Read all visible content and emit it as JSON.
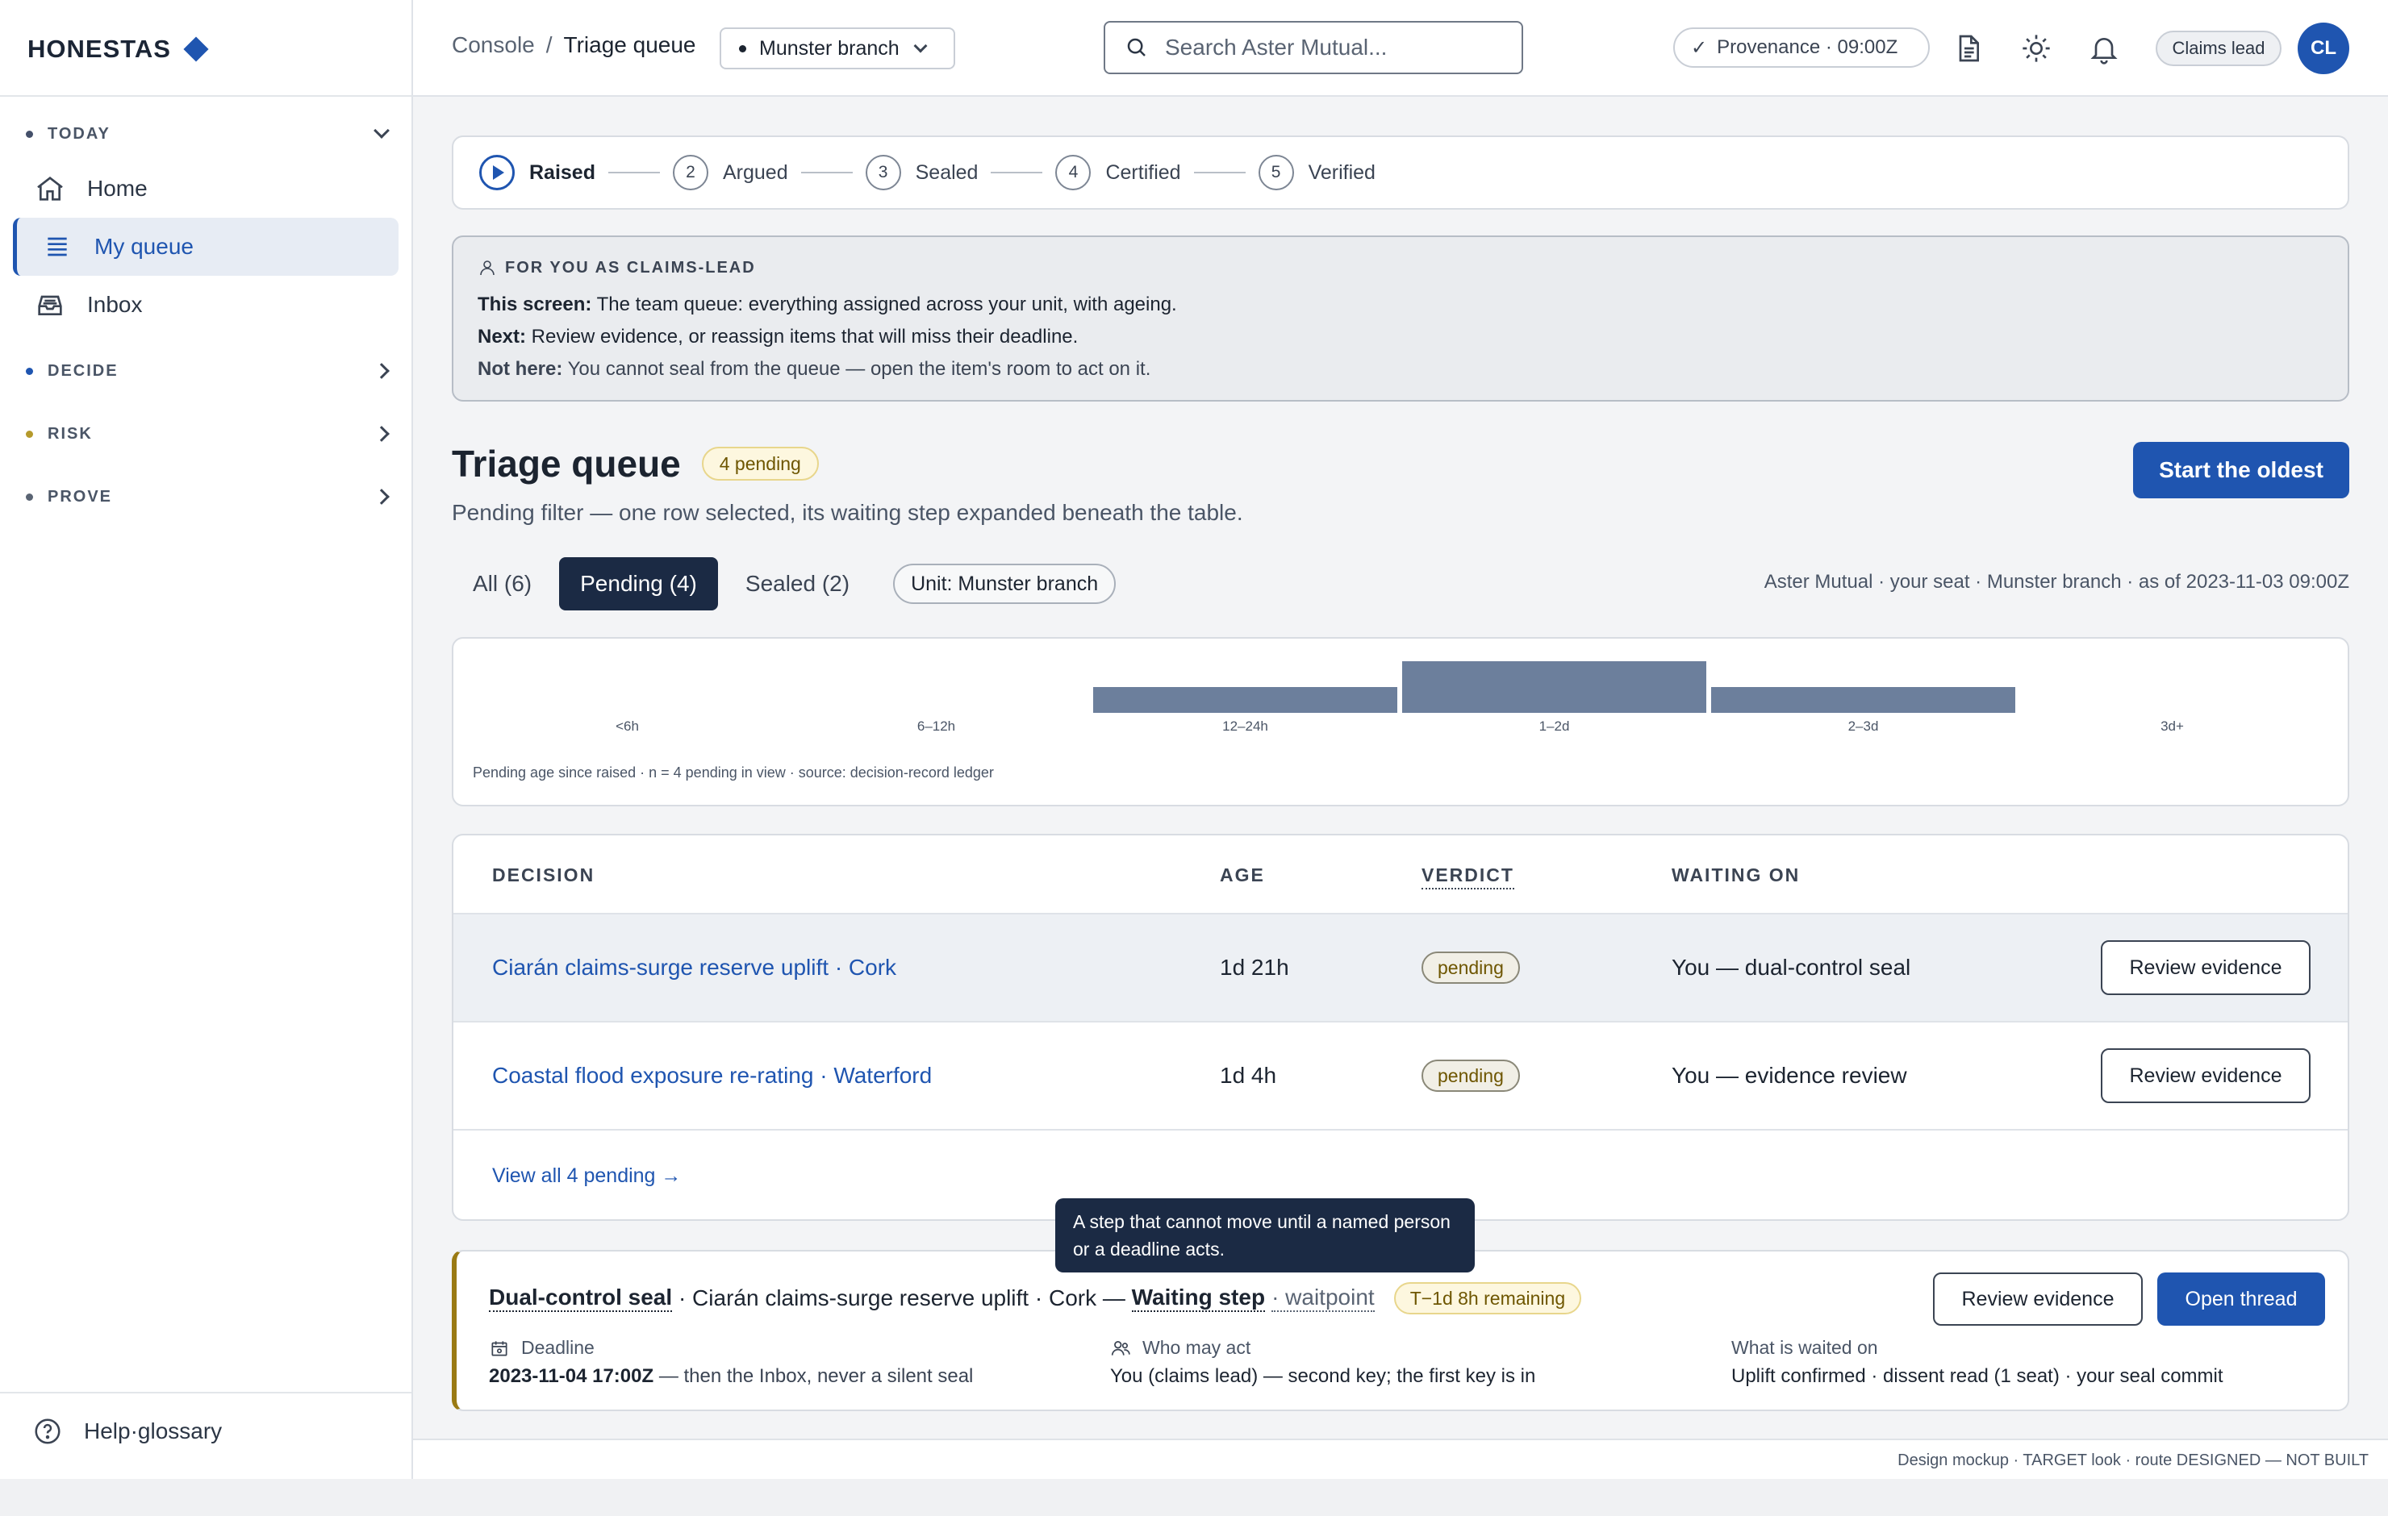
{
  "brand": {
    "name": "HONESTAS"
  },
  "sidebar": {
    "sections": [
      {
        "label": "TODAY",
        "dot": "#44506a",
        "expanded": true
      },
      {
        "label": "DECIDE",
        "dot": "#1f55b0"
      },
      {
        "label": "RISK",
        "dot": "#b59a2c"
      },
      {
        "label": "PROVE",
        "dot": "#5a6473"
      }
    ],
    "items": [
      {
        "label": "Home",
        "icon": "home-icon"
      },
      {
        "label": "My queue",
        "icon": "list-icon",
        "active": true
      },
      {
        "label": "Inbox",
        "icon": "inbox-icon"
      }
    ],
    "help": "Help·glossary"
  },
  "header": {
    "crumb_root": "Console",
    "crumb_sep": "/",
    "crumb_current": "Triage queue",
    "branch": "Munster branch",
    "search_placeholder": "Search Aster Mutual...",
    "provenance": "Provenance · 09:00Z",
    "role": "Claims lead",
    "avatar": "CL"
  },
  "stepper": [
    {
      "num": "",
      "label": "Raised",
      "active": true
    },
    {
      "num": "2",
      "label": "Argued"
    },
    {
      "num": "3",
      "label": "Sealed"
    },
    {
      "num": "4",
      "label": "Certified"
    },
    {
      "num": "5",
      "label": "Verified"
    }
  ],
  "info": {
    "heading": "FOR YOU AS CLAIMS-LEAD",
    "screen_label": "This screen:",
    "screen_text": " The team queue: everything assigned across your unit, with ageing.",
    "next_label": "Next:",
    "next_text": " Review evidence, or reassign items that will miss their deadline.",
    "not_label": "Not here:",
    "not_text": " You cannot seal from the queue — open the item's room to act on it."
  },
  "page": {
    "title": "Triage queue",
    "pending_pill": "4 pending",
    "subtitle": "Pending filter — one row selected, its waiting step expanded beneath the table.",
    "primary_action": "Start the oldest",
    "seat_note": "Aster Mutual · your seat · Munster branch · as of 2023-11-03 09:00Z"
  },
  "filters": {
    "tabs": [
      {
        "label": "All (6)"
      },
      {
        "label": "Pending (4)",
        "active": true
      },
      {
        "label": "Sealed (2)"
      }
    ],
    "unit_chip": "Unit: Munster branch"
  },
  "chart_data": {
    "type": "bar",
    "categories": [
      "<6h",
      "6–12h",
      "12–24h",
      "1–2d",
      "2–3d",
      "3d+"
    ],
    "values": [
      0,
      0,
      1,
      2,
      1,
      0
    ],
    "ylim": [
      0,
      2
    ],
    "caption": "Pending age since raised · n = 4 pending in view · source: decision-record ledger",
    "bar_color": "#6c7f9c"
  },
  "table": {
    "headers": {
      "decision": "DECISION",
      "age": "AGE",
      "verdict": "VERDICT",
      "waiting": "WAITING ON"
    },
    "rows": [
      {
        "decision": "Ciarán claims-surge reserve uplift · Cork",
        "age": "1d 21h",
        "verdict": "pending",
        "waiting": "You — dual-control seal",
        "action": "Review evidence"
      },
      {
        "decision": "Coastal flood exposure re-rating · Waterford",
        "age": "1d 4h",
        "verdict": "pending",
        "waiting": "You — evidence review",
        "action": "Review evidence"
      }
    ],
    "view_all": "View all 4 pending →"
  },
  "tooltip": "A step that cannot move until a named person or a deadline acts.",
  "waitpoint": {
    "step": "Dual-control seal",
    "context": " · Ciarán claims-surge reserve uplift · Cork — ",
    "waiting_step": "Waiting step",
    "kind": "· waitpoint",
    "remaining": "T−1d 8h remaining",
    "review": "Review evidence",
    "open": "Open thread",
    "deadline_label": "Deadline",
    "deadline_value": "2023-11-04 17:00Z",
    "deadline_note": " — then the Inbox, never a silent seal",
    "who_label": "Who may act",
    "who_value": "You (claims lead) — second key; the first key is in",
    "what_label": "What is waited on",
    "what_value": "Uplift confirmed · dissent read (1 seat) · your seal commit"
  },
  "footer": "Design mockup · TARGET look · route DESIGNED — NOT BUILT"
}
